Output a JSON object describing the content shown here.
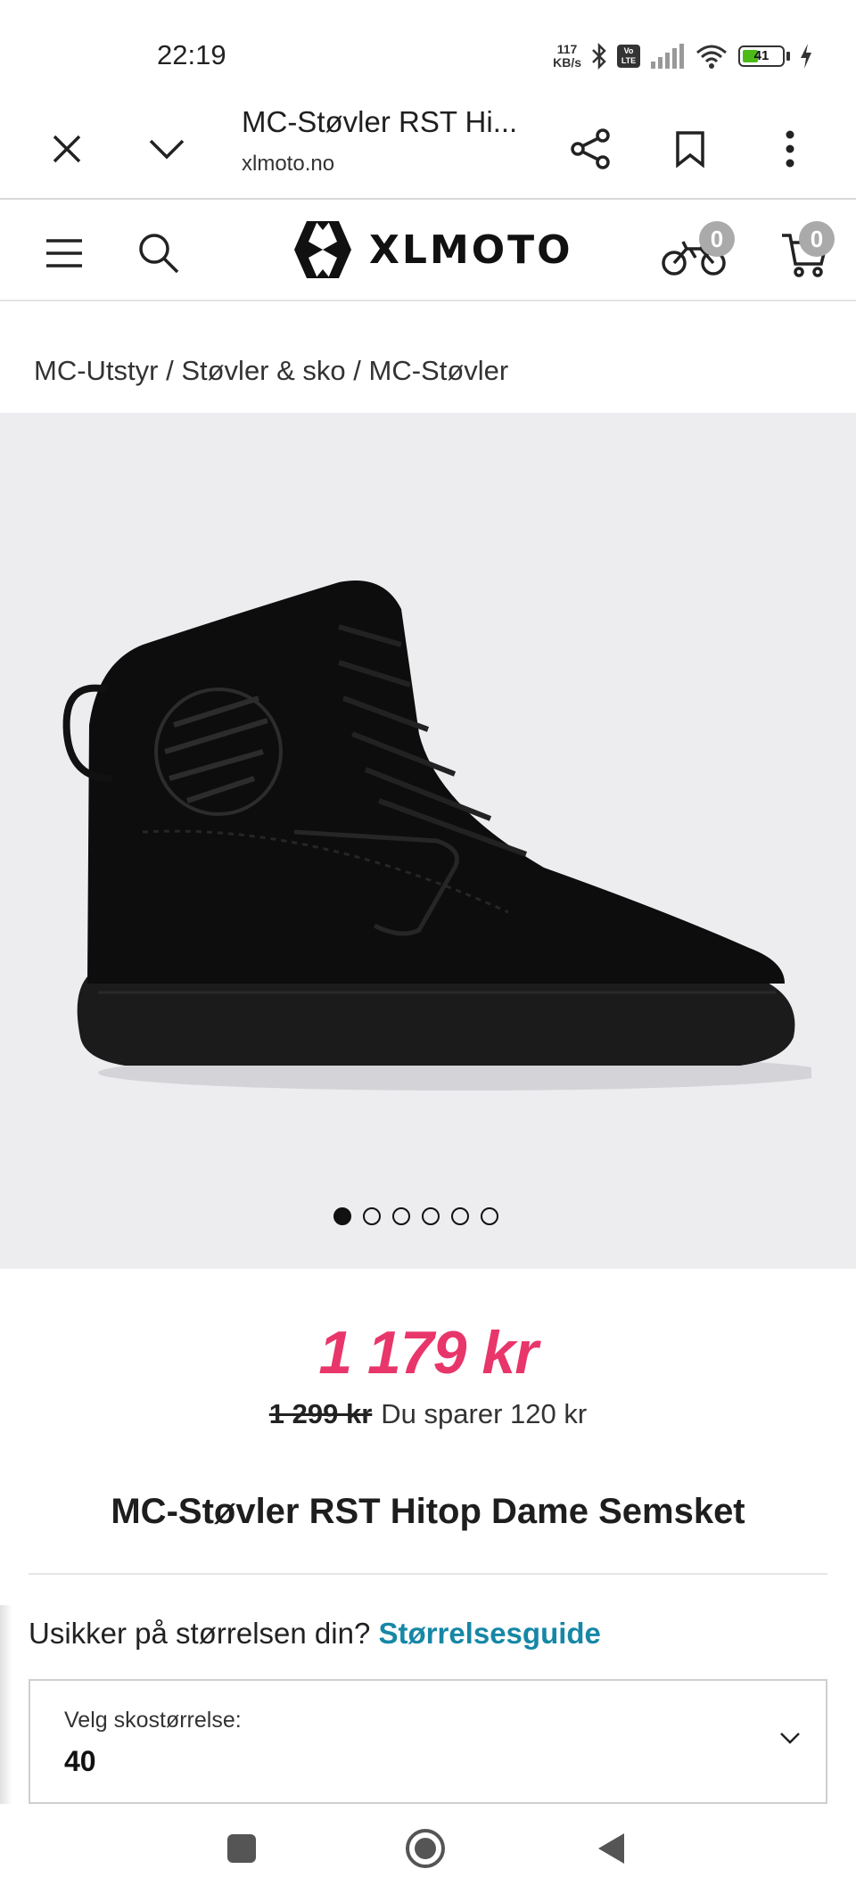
{
  "status_bar": {
    "time": "22:19",
    "net_speed_value": "117",
    "net_speed_unit": "KB/s",
    "volte": "Vo LTE",
    "battery_level": "41",
    "icons": [
      "bluetooth-icon",
      "volte-icon",
      "signal-icon",
      "wifi-icon",
      "battery-icon",
      "charging-icon"
    ]
  },
  "browser": {
    "tab_title": "MC-Støvler RST Hi...",
    "domain": "xlmoto.no",
    "icons": [
      "close-icon",
      "chevron-down-icon",
      "share-icon",
      "bookmark-icon",
      "more-vert-icon"
    ]
  },
  "site_header": {
    "logo_text": "XLMOTO",
    "garage_count": "0",
    "cart_count": "0",
    "icons": [
      "menu-icon",
      "search-icon",
      "motorcycle-icon",
      "cart-icon"
    ]
  },
  "breadcrumb": {
    "items": [
      "MC-Utstyr",
      "Støvler & sko",
      "MC-Støvler"
    ],
    "separator": " / "
  },
  "gallery": {
    "image_count": 6,
    "active_index": 0
  },
  "product": {
    "price": "1 179 kr",
    "old_price": "1 299 kr",
    "savings": "Du sparer 120 kr",
    "title": "MC-Støvler RST Hitop Dame Semsket",
    "price_color": "#e8366b"
  },
  "size": {
    "help_text": "Usikker på størrelsen din?",
    "guide_link": "Størrelsesguide",
    "select_label": "Velg skostørrelse:",
    "select_value": "40",
    "link_color": "#1687a6"
  },
  "nav_bar": {
    "icons": [
      "recents-icon",
      "home-icon",
      "back-icon"
    ]
  }
}
